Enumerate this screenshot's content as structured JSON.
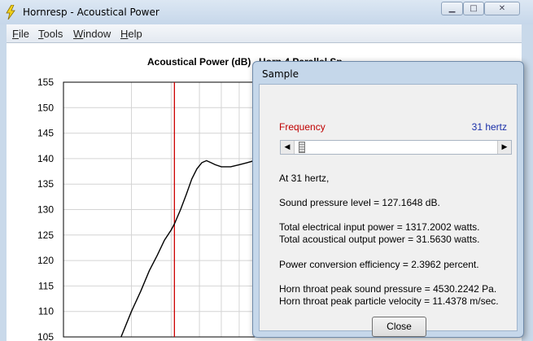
{
  "window": {
    "title": "Hornresp - Acoustical Power"
  },
  "menu": [
    "File",
    "Tools",
    "Window",
    "Help"
  ],
  "chart_data": {
    "type": "line",
    "title": "Acoustical Power (dB)",
    "title_partial": "Horn 4 Parallel Sp",
    "ylim": [
      105,
      155
    ],
    "yticks": [
      "155",
      "150",
      "145",
      "140",
      "135",
      "130",
      "125",
      "120",
      "115",
      "110",
      "105"
    ],
    "xscale": "log",
    "xlim": [
      10,
      1000
    ],
    "grid": true,
    "marker_frequency_hz": 31,
    "marker_color": "#cc0000",
    "series": [
      {
        "x": [
          18,
          20,
          22,
          24,
          26,
          28,
          30,
          31,
          33,
          35,
          37,
          39,
          41,
          43,
          45,
          47,
          50,
          55,
          60,
          65,
          70,
          75,
          80,
          85,
          90,
          95,
          100,
          105,
          110,
          115,
          120,
          125,
          130,
          135,
          140,
          145,
          150,
          153,
          155,
          158,
          160
        ],
        "y": [
          105,
          110,
          114,
          118,
          121,
          124,
          126,
          127.2,
          130,
          133,
          136,
          138,
          139.2,
          139.6,
          139.2,
          138.8,
          138.4,
          138.4,
          138.8,
          139.2,
          139.6,
          139.4,
          138.8,
          140.0,
          137.0,
          134.0,
          134.0,
          136.5,
          139.0,
          140.3,
          138.5,
          134.0,
          126.0,
          117.0,
          110.0,
          105.5,
          108.0,
          112.0,
          110.0,
          106.0,
          105.0
        ]
      }
    ]
  },
  "dialog": {
    "title": "Sample",
    "frequency_label": "Frequency",
    "frequency_value": "31 hertz",
    "slider_value_hz": 31,
    "line_at": "At 31 hertz,",
    "line_spl": "Sound pressure level = 127.1648 dB.",
    "line_input": "Total electrical input power = 1317.2002 watts.",
    "line_output": "Total acoustical output power = 31.5630 watts.",
    "line_efficiency": "Power conversion efficiency = 2.3962 percent.",
    "line_throat_pressure": "Horn throat peak sound pressure = 4530.2242 Pa.",
    "line_throat_velocity": "Horn throat peak particle velocity = 11.4378 m/sec.",
    "close_label": "Close"
  }
}
